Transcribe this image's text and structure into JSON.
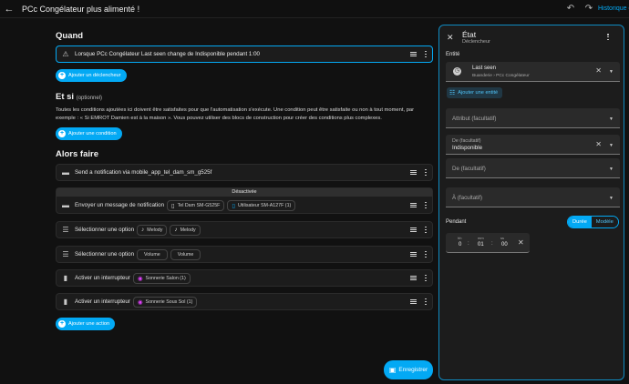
{
  "topbar": {
    "title": "PCc Congélateur plus alimenté !",
    "history_label": "Historique d"
  },
  "when": {
    "title": "Quand",
    "trigger_text": "Lorsque PCc Congélateur Last seen change de Indisponible pendant 1:00",
    "add_trigger_label": "Ajouter un déclencheur"
  },
  "if": {
    "title": "Et si",
    "optional": "(optionnel)",
    "description": "Toutes les conditions ajoutées ici doivent être satisfaites pour que l'automatisation s'exécute. Une condition peut être satisfaite ou non à tout moment, par exemple : « Si EMROT Damien est à la maison ». Vous pouvez utiliser des blocs de construction pour créer des conditions plus complexes.",
    "add_condition_label": "Ajouter une condition"
  },
  "then": {
    "title": "Alors faire",
    "actions": [
      {
        "text": "Send a notification via mobile_app_tel_dam_sm_g525f"
      },
      {
        "text": "Envoyer un message de notification",
        "disabled_banner": "Désactivée",
        "chips": [
          "Tel Dam SM-G525F",
          "Utilisateur SM-A127F (1)"
        ]
      },
      {
        "text": "Sélectionner une option",
        "chips": [
          "Melody",
          "Melody"
        ]
      },
      {
        "text": "Sélectionner une option",
        "chips": [
          "Volume",
          "Volume"
        ]
      },
      {
        "text": "Activer un interrupteur",
        "chips": [
          "Sonnerie Salon (1)"
        ]
      },
      {
        "text": "Activer un interrupteur",
        "chips": [
          "Sonnerie Sous Sol (1)"
        ]
      }
    ],
    "add_action_label": "Ajouter une action"
  },
  "save_label": "Enregistrer",
  "panel": {
    "title": "État",
    "subtitle": "Déclencheur",
    "entity_label": "Entité",
    "entity_name": "Last seen",
    "entity_path": "Buanderie  ›  PCc Congélateur",
    "add_entity_label": "Ajouter une entité",
    "attribute_placeholder": "Attribut (facultatif)",
    "from_label": "De (facultatif)",
    "from_value": "Indisponible",
    "from2_placeholder": "De (facultatif)",
    "to_placeholder": "À (facultatif)",
    "duration_label": "Pendant",
    "seg_duration": "Durée",
    "seg_template": "Modèle",
    "duration": {
      "h_label": "hh",
      "m_label": "mm",
      "s_label": "ss",
      "h": "0",
      "m": "01",
      "s": "00"
    }
  },
  "colors": {
    "accent": "#03a9f4",
    "background": "#111111",
    "card": "#1c1c1c"
  }
}
